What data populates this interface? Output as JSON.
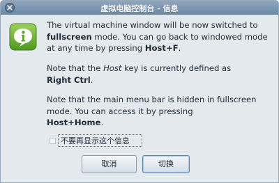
{
  "window": {
    "title": "虚拟电脑控制台 - 信息"
  },
  "icons": {
    "info": "info-icon",
    "close": "close-icon"
  },
  "message": {
    "p1_a": "The virtual machine window will be now switched to ",
    "p1_b": "fullscreen",
    "p1_c": " mode. You can go back to windowed mode at any time by pressing ",
    "p1_d": "Host+F",
    "p1_e": ".",
    "p2_a": "Note that the ",
    "p2_b": "Host",
    "p2_c": " key is currently defined as ",
    "p2_d": "Right Ctrl",
    "p2_e": ".",
    "p3_a": "Note that the main menu bar is hidden in fullscreen mode. You can access it by pressing ",
    "p3_b": "Host+Home",
    "p3_c": "."
  },
  "checkbox": {
    "label": "不要再显示这个信息",
    "checked": false
  },
  "buttons": {
    "cancel": "取消",
    "switch": "切换"
  },
  "colors": {
    "titlebar": "#7f98b2",
    "background": "#e4e9ee",
    "icon_green": "#6cae2b"
  }
}
